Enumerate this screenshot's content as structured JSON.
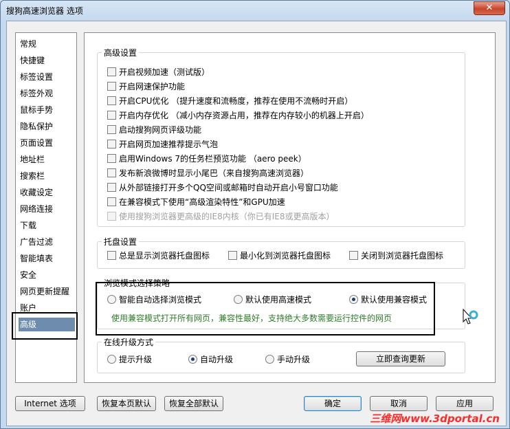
{
  "window": {
    "title": "搜狗高速浏览器 选项",
    "close_label": "✕"
  },
  "sidebar": {
    "items": [
      {
        "label": "常规"
      },
      {
        "label": "快捷键"
      },
      {
        "label": "标签设置"
      },
      {
        "label": "标签外观"
      },
      {
        "label": "鼠标手势"
      },
      {
        "label": "隐私保护"
      },
      {
        "label": "页面设置"
      },
      {
        "label": "地址栏"
      },
      {
        "label": "搜索栏"
      },
      {
        "label": "收藏设定"
      },
      {
        "label": "网络连接"
      },
      {
        "label": "下载"
      },
      {
        "label": "广告过滤"
      },
      {
        "label": "智能填表"
      },
      {
        "label": "安全"
      },
      {
        "label": "网页更新提醒"
      },
      {
        "label": "账户"
      },
      {
        "label": "高级",
        "selected": true
      }
    ]
  },
  "advanced": {
    "title": "高级设置",
    "options": [
      {
        "label": "开启视频加速（测试版）",
        "checked": false
      },
      {
        "label": "开启网速保护功能",
        "checked": false
      },
      {
        "label": "开启CPU优化 （提升速度和流畅度，推荐在使用不流畅时开启）",
        "checked": false
      },
      {
        "label": "开启内存优化 （减小内存资源占用，推荐在内存较小的机器上开启）",
        "checked": false
      },
      {
        "label": "启动搜狗网页评级功能",
        "checked": false
      },
      {
        "label": "开启网页加速推荐提示气泡",
        "checked": false
      },
      {
        "label": "启用Windows 7的任务栏预览功能 （aero peek）",
        "checked": false
      },
      {
        "label": "发布新浪微博时显示小尾巴（来自搜狗高速浏览器）",
        "checked": false
      },
      {
        "label": "从外部链接打开多个QQ空间或邮箱时自动开启小号窗口功能",
        "checked": false
      },
      {
        "label": "在兼容模式下使用“高级渲染特性”和GPU加速",
        "checked": false
      },
      {
        "label": "使用搜狗浏览器更高级的IE8内核（你已有IE8或更高版本）",
        "checked": false,
        "disabled": true
      }
    ]
  },
  "tray": {
    "title": "托盘设置",
    "options": [
      {
        "label": "总是显示浏览器托盘图标",
        "checked": false
      },
      {
        "label": "最小化到浏览器托盘图标",
        "checked": false
      },
      {
        "label": "关闭到浏览器托盘图标",
        "checked": false
      }
    ]
  },
  "browse_mode": {
    "title": "浏览模式选择策略",
    "options": [
      {
        "label": "智能自动选择浏览模式",
        "selected": false
      },
      {
        "label": "默认使用高速模式",
        "selected": false
      },
      {
        "label": "默认使用兼容模式",
        "selected": true
      }
    ],
    "hint": "使用兼容模式打开所有网页，兼容性最好，支持绝大多数需要运行控件的网页"
  },
  "upgrade": {
    "title": "在线升级方式",
    "options": [
      {
        "label": "提示升级",
        "selected": false
      },
      {
        "label": "自动升级",
        "selected": true
      },
      {
        "label": "手动升级",
        "selected": false
      }
    ],
    "check_now": "立即查询更新"
  },
  "buttons": {
    "internet": "Internet 选项",
    "restore_page": "恢复本页默认",
    "restore_all": "恢复全部默认",
    "ok": "确定",
    "cancel": "取消",
    "apply": "应用"
  },
  "watermark": "三维网www.3dportal.cn",
  "icons": {
    "cursor": "busy-cursor-icon",
    "close": "close-icon"
  },
  "colors": {
    "selected_bg": "#6d8cae",
    "hint_text": "#2f7d2a",
    "watermark": "#ff2a2a"
  }
}
